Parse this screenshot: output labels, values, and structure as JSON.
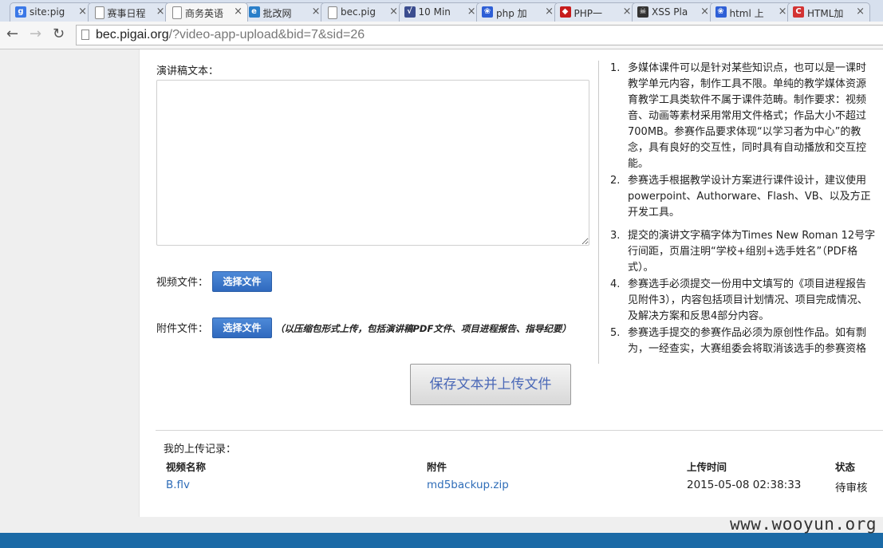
{
  "browser": {
    "tabs": [
      {
        "title": "site:pig",
        "favicon": "google-icon",
        "color": "#3b78e7",
        "glyph": "g"
      },
      {
        "title": "赛事日程",
        "favicon": "page-icon",
        "color": "",
        "glyph": ""
      },
      {
        "title": "商务英语",
        "favicon": "page-icon",
        "color": "",
        "glyph": ""
      },
      {
        "title": "批改网",
        "favicon": "pigai-icon",
        "color": "#2a7fc9",
        "glyph": "e"
      },
      {
        "title": "bec.pig",
        "favicon": "page-icon",
        "color": "",
        "glyph": ""
      },
      {
        "title": "10 Min",
        "favicon": "chart-icon",
        "color": "#3b4d8f",
        "glyph": "√"
      },
      {
        "title": "php 加",
        "favicon": "baidu-paw-icon",
        "color": "#2e5fd6",
        "glyph": "❀"
      },
      {
        "title": "PHP一",
        "favicon": "redhat-icon",
        "color": "#c71c1c",
        "glyph": "◆"
      },
      {
        "title": "XSS Pla",
        "favicon": "skull-icon",
        "color": "#333333",
        "glyph": "☠"
      },
      {
        "title": "html 上",
        "favicon": "baidu-paw-icon",
        "color": "#2e5fd6",
        "glyph": "❀"
      },
      {
        "title": "HTML加",
        "favicon": "csdn-icon",
        "color": "#d33333",
        "glyph": "C"
      }
    ],
    "active_tab": 2,
    "url_host": "bec.pigai.org",
    "url_path": "/?video-app-upload&bid=7&sid=26"
  },
  "form": {
    "speech_label": "演讲稿文本：",
    "video_label": "视频文件：",
    "attach_label": "附件文件：",
    "choose_file": "选择文件",
    "attach_note": "（以压缩包形式上传，包括演讲稿PDF文件、项目进程报告、指导纪要）",
    "save_button": "保存文本并上传文件"
  },
  "rules": [
    {
      "num": "1.",
      "lines": [
        "多媒体课件可以是针对某些知识点，也可以是一课时",
        "教学单元内容，制作工具不限。单纯的教学媒体资源",
        "育教学工具类软件不属于课件范畴。制作要求：视频",
        "音、动画等素材采用常用文件格式；作品大小不超过",
        "700MB。参赛作品要求体现“以学习者为中心”的教",
        "念，具有良好的交互性，同时具有自动播放和交互控",
        "能。"
      ]
    },
    {
      "num": "2.",
      "lines": [
        "参赛选手根据教学设计方案进行课件设计，建议使用",
        "powerpoint、Authorware、Flash、VB、以及方正",
        "开发工具。"
      ]
    },
    {
      "num": "3.",
      "lines": [
        "提交的演讲文字稿字体为Times New Roman 12号字",
        "行间距，页眉注明“学校+组别+选手姓名”（PDF格",
        "式）。"
      ]
    },
    {
      "num": "4.",
      "lines": [
        "参赛选手必须提交一份用中文填写的《项目进程报告",
        "见附件3），内容包括项目计划情况、项目完成情况、",
        "及解决方案和反思4部分内容。"
      ]
    },
    {
      "num": "5.",
      "lines": [
        "参赛选手提交的参赛作品必须为原创性作品。如有剽",
        "为，一经查实，大赛组委会将取消该选手的参赛资格"
      ]
    }
  ],
  "records": {
    "title": "我的上传记录：",
    "columns": [
      "视频名称",
      "附件",
      "上传时间",
      "状态"
    ],
    "rows": [
      {
        "video": "B.flv",
        "attachment": "md5backup.zip",
        "time": "2015-05-08 02:38:33",
        "status": "待审核"
      }
    ]
  },
  "watermark": "www.wooyun.org"
}
